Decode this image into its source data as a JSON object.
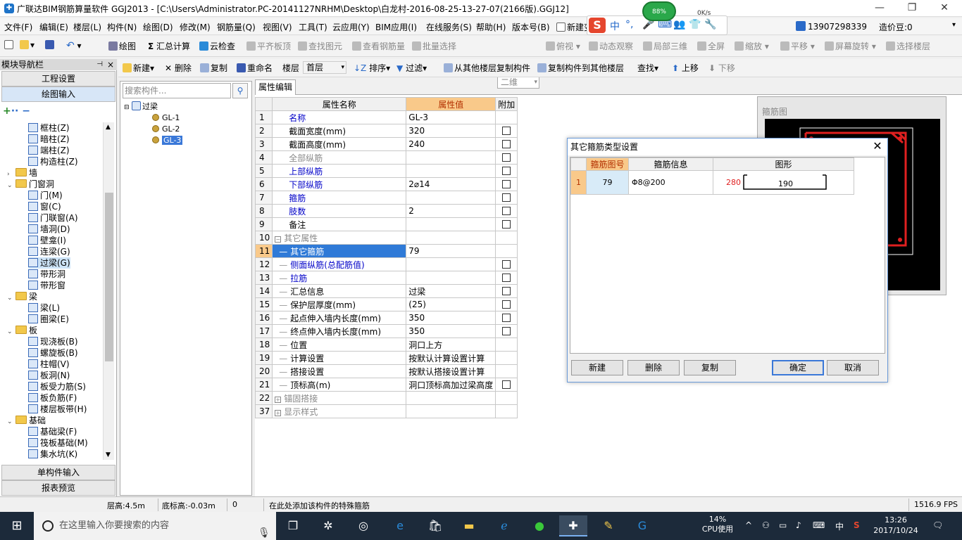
{
  "window": {
    "title": "广联达BIM钢筋算量软件 GGJ2013 - [C:\\Users\\Administrator.PC-20141127NRHM\\Desktop\\白龙村-2016-08-25-13-27-07(2166版).GGJ12]",
    "app_icon": "ggj-app-icon"
  },
  "ime": {
    "label_zh": "中",
    "net_speed": "0K/s",
    "net_badge": "88%"
  },
  "menu": {
    "items": [
      "文件(F)",
      "编辑(E)",
      "楼层(L)",
      "构件(N)",
      "绘图(D)",
      "修改(M)",
      "钢筋量(Q)",
      "视图(V)",
      "工具(T)",
      "云应用(Y)",
      "BIM应用(I)",
      "在线服务(S)",
      "帮助(H)",
      "版本号(B)",
      "新建变更"
    ],
    "phone": "13907298339",
    "cost_beans": "造价豆:0"
  },
  "toolbar1": {
    "draw": "绘图",
    "sum": "汇总计算",
    "cloud_check": "云检查",
    "flush_top": "平齐板顶",
    "find_elem": "查找图元",
    "view_rebar": "查看钢筋量",
    "batch_select": "批量选择",
    "view_mode": "二维",
    "top_view": "俯视",
    "dynamic_view": "动态观察",
    "local_3d": "局部三维",
    "fullscreen": "全屏",
    "zoom": "缩放",
    "pan": "平移",
    "rotate": "屏幕旋转",
    "select_floor": "选择楼层"
  },
  "nav": {
    "title": "模块导航栏",
    "project_settings": "工程设置",
    "drawing_input": "绘图输入",
    "single_input": "单构件输入",
    "report_preview": "报表预览",
    "tree": [
      {
        "label": "框柱(Z)",
        "level": 2
      },
      {
        "label": "暗柱(Z)",
        "level": 2
      },
      {
        "label": "端柱(Z)",
        "level": 2
      },
      {
        "label": "构造柱(Z)",
        "level": 2
      },
      {
        "label": "墙",
        "level": 1,
        "folder": true,
        "collapsed": true
      },
      {
        "label": "门窗洞",
        "level": 1,
        "folder": true
      },
      {
        "label": "门(M)",
        "level": 2
      },
      {
        "label": "窗(C)",
        "level": 2
      },
      {
        "label": "门联窗(A)",
        "level": 2
      },
      {
        "label": "墙洞(D)",
        "level": 2
      },
      {
        "label": "壁龛(I)",
        "level": 2
      },
      {
        "label": "连梁(G)",
        "level": 2
      },
      {
        "label": "过梁(G)",
        "level": 2,
        "selected": true
      },
      {
        "label": "带形洞",
        "level": 2
      },
      {
        "label": "带形窗",
        "level": 2
      },
      {
        "label": "梁",
        "level": 1,
        "folder": true
      },
      {
        "label": "梁(L)",
        "level": 2
      },
      {
        "label": "圈梁(E)",
        "level": 2
      },
      {
        "label": "板",
        "level": 1,
        "folder": true
      },
      {
        "label": "现浇板(B)",
        "level": 2
      },
      {
        "label": "螺旋板(B)",
        "level": 2
      },
      {
        "label": "柱帽(V)",
        "level": 2
      },
      {
        "label": "板洞(N)",
        "level": 2
      },
      {
        "label": "板受力筋(S)",
        "level": 2
      },
      {
        "label": "板负筋(F)",
        "level": 2
      },
      {
        "label": "楼层板带(H)",
        "level": 2
      },
      {
        "label": "基础",
        "level": 1,
        "folder": true
      },
      {
        "label": "基础梁(F)",
        "level": 2
      },
      {
        "label": "筏板基础(M)",
        "level": 2
      },
      {
        "label": "集水坑(K)",
        "level": 2
      }
    ]
  },
  "toolbar2": {
    "new": "新建",
    "delete": "删除",
    "copy": "复制",
    "rename": "重命名",
    "floor_label": "楼层",
    "floor_value": "首层",
    "sort": "排序",
    "filter": "过滤",
    "copy_from_floor": "从其他楼层复制构件",
    "copy_to_floor": "复制构件到其他楼层",
    "find": "查找",
    "move_up": "上移",
    "move_down": "下移"
  },
  "components": {
    "search_placeholder": "搜索构件...",
    "root": "过梁",
    "items": [
      {
        "label": "GL-1"
      },
      {
        "label": "GL-2"
      },
      {
        "label": "GL-3",
        "selected": true
      }
    ]
  },
  "props": {
    "tab": "属性编辑",
    "header": {
      "name": "属性名称",
      "value": "属性值",
      "extra": "附加"
    },
    "rows": [
      {
        "num": "1",
        "name": "名称",
        "value": "GL-3",
        "style": "blue",
        "checkbox": false
      },
      {
        "num": "2",
        "name": "截面宽度(mm)",
        "value": "320",
        "style": "",
        "checkbox": true
      },
      {
        "num": "3",
        "name": "截面高度(mm)",
        "value": "240",
        "style": "",
        "checkbox": true
      },
      {
        "num": "4",
        "name": "全部纵筋",
        "value": "",
        "style": "gray",
        "checkbox": true
      },
      {
        "num": "5",
        "name": "上部纵筋",
        "value": "",
        "style": "blue",
        "checkbox": true
      },
      {
        "num": "6",
        "name": "下部纵筋",
        "value": "2⌀14",
        "style": "blue",
        "checkbox": true
      },
      {
        "num": "7",
        "name": "箍筋",
        "value": "",
        "style": "blue",
        "checkbox": true
      },
      {
        "num": "8",
        "name": "肢数",
        "value": "2",
        "style": "blue",
        "checkbox": true
      },
      {
        "num": "9",
        "name": "备注",
        "value": "",
        "style": "",
        "checkbox": true
      },
      {
        "num": "10",
        "name": "其它属性",
        "value": "",
        "style": "gray",
        "group": "minus",
        "checkbox": false
      },
      {
        "num": "11",
        "name": "其它箍筋",
        "value": "79",
        "style": "",
        "selected": true,
        "indent": true,
        "checkbox": false
      },
      {
        "num": "12",
        "name": "侧面纵筋(总配筋值)",
        "value": "",
        "style": "blue",
        "indent": true,
        "checkbox": true
      },
      {
        "num": "13",
        "name": "拉筋",
        "value": "",
        "style": "blue",
        "indent": true,
        "checkbox": true
      },
      {
        "num": "14",
        "name": "汇总信息",
        "value": "过梁",
        "style": "",
        "indent": true,
        "checkbox": true
      },
      {
        "num": "15",
        "name": "保护层厚度(mm)",
        "value": "(25)",
        "style": "",
        "indent": true,
        "checkbox": true
      },
      {
        "num": "16",
        "name": "起点伸入墙内长度(mm)",
        "value": "350",
        "style": "",
        "indent": true,
        "checkbox": true
      },
      {
        "num": "17",
        "name": "终点伸入墙内长度(mm)",
        "value": "350",
        "style": "",
        "indent": true,
        "checkbox": true
      },
      {
        "num": "18",
        "name": "位置",
        "value": "洞口上方",
        "style": "",
        "indent": true,
        "checkbox": false
      },
      {
        "num": "19",
        "name": "计算设置",
        "value": "按默认计算设置计算",
        "style": "",
        "indent": true,
        "checkbox": false
      },
      {
        "num": "20",
        "name": "搭接设置",
        "value": "按默认搭接设置计算",
        "style": "",
        "indent": true,
        "checkbox": false
      },
      {
        "num": "21",
        "name": "顶标高(m)",
        "value": "洞口顶标高加过梁高度",
        "style": "",
        "indent": true,
        "checkbox": true
      },
      {
        "num": "22",
        "name": "锚固搭接",
        "value": "",
        "style": "gray",
        "group": "plus",
        "checkbox": false
      },
      {
        "num": "37",
        "name": "显示样式",
        "value": "",
        "style": "gray",
        "group": "plus",
        "checkbox": false
      }
    ]
  },
  "stirrup_panel": {
    "label": "箍筋图"
  },
  "dialog": {
    "title": "其它箍筋类型设置",
    "headers": {
      "code": "箍筋图号",
      "info": "箍筋信息",
      "shape": "图形"
    },
    "row": {
      "num": "1",
      "code": "79",
      "info": "Φ8@200",
      "left_len": "280",
      "bottom_len": "190"
    },
    "buttons": {
      "new": "新建",
      "delete": "删除",
      "copy": "复制",
      "ok": "确定",
      "cancel": "取消"
    }
  },
  "status": {
    "floor_height": "层高:4.5m",
    "bottom_elev": "底标高:-0.03m",
    "zero": "0",
    "hint": "在此处添加该构件的特殊箍筋",
    "fps": "1516.9 FPS"
  },
  "taskbar": {
    "search_placeholder": "在这里输入你要搜索的内容",
    "cpu_pct": "14%",
    "cpu_label": "CPU使用",
    "ime": "中",
    "time": "13:26",
    "date": "2017/10/24"
  },
  "colors": {
    "selection_blue": "#2f7ad7",
    "header_orange": "#f9c98a",
    "property_blue": "#0000c8",
    "preview_red": "#e02020"
  }
}
